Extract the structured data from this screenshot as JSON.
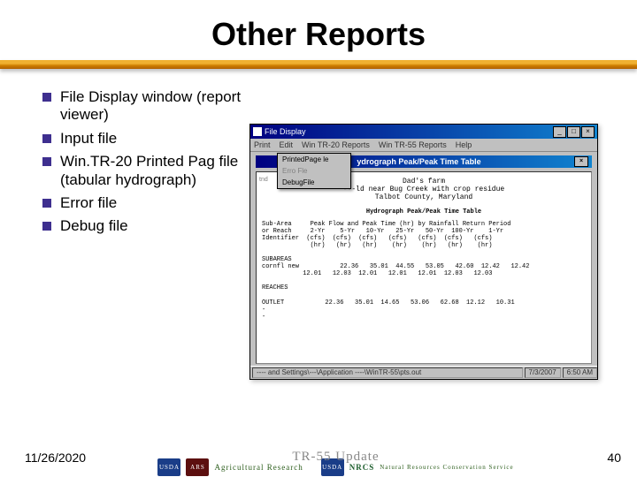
{
  "slide": {
    "title": "Other Reports",
    "bullets": [
      "File Display window (report viewer)",
      "Input file",
      "Win.TR-20 Printed Pag file (tabular hydrograph)",
      "Error file",
      "Debug file"
    ],
    "date": "11/26/2020",
    "center_caption": "TR-55 Update",
    "page": "40"
  },
  "window": {
    "title": "File Display",
    "menu": [
      "Print",
      "Edit",
      "Win TR-20 Reports",
      "Win TR-55 Reports",
      "Help"
    ],
    "dropdown": {
      "items": [
        "PrintedPage  le",
        "Erro Fle",
        "DebugFile"
      ],
      "disabled_index": 1
    },
    "inner_title": "ydrograph Peak/Peak Time Table",
    "report": {
      "tnd_label": "tnd",
      "line1": "Dad's farm",
      "line2": "---ld near Bug Creek with crop residue",
      "line3": "Talbot County, Maryland",
      "section_title": "Hydrograph Peak/Peak Time Table",
      "col_header1": "Sub-Area     Peak Flow and Peak Time (hr) by Rainfall Return Period",
      "col_header2": "or Reach     2-Yr    5-Yr   10-Yr   25-Yr   50-Yr  100-Yr    1-Yr",
      "col_header3": "Identifier  (cfs)  (cfs)  (cfs)   (cfs)   (cfs)  (cfs)   (cfs)",
      "col_header4": "             (hr)   (hr)   (hr)    (hr)    (hr)   (hr)    (hr)",
      "group1": "SUBAREAS",
      "row1_name": "cornfl new",
      "row1_vals": "           22.36   35.01  44.55   53.05   42.60  12.42   12.42",
      "row1_hrs": "           12.01   12.03  12.01   12.01   12.01  12.03   12.03",
      "group2": "REACHES",
      "row2_name": "OUTLET",
      "row2_vals": "           22.36   35.01  14.65   53.06   62.68  12.12   10.31"
    },
    "statusbar": {
      "path": "---- and Settings\\---\\Application ----\\WinTR-55\\pts.out",
      "date": "7/3/2007",
      "time": "6:50 AM"
    }
  },
  "logos": {
    "usda": "USDA",
    "ars": "ARS",
    "ars_text": "Agricultural Research",
    "nrcs": "NRCS",
    "nrcs_text": "Natural Resources Conservation Service"
  }
}
